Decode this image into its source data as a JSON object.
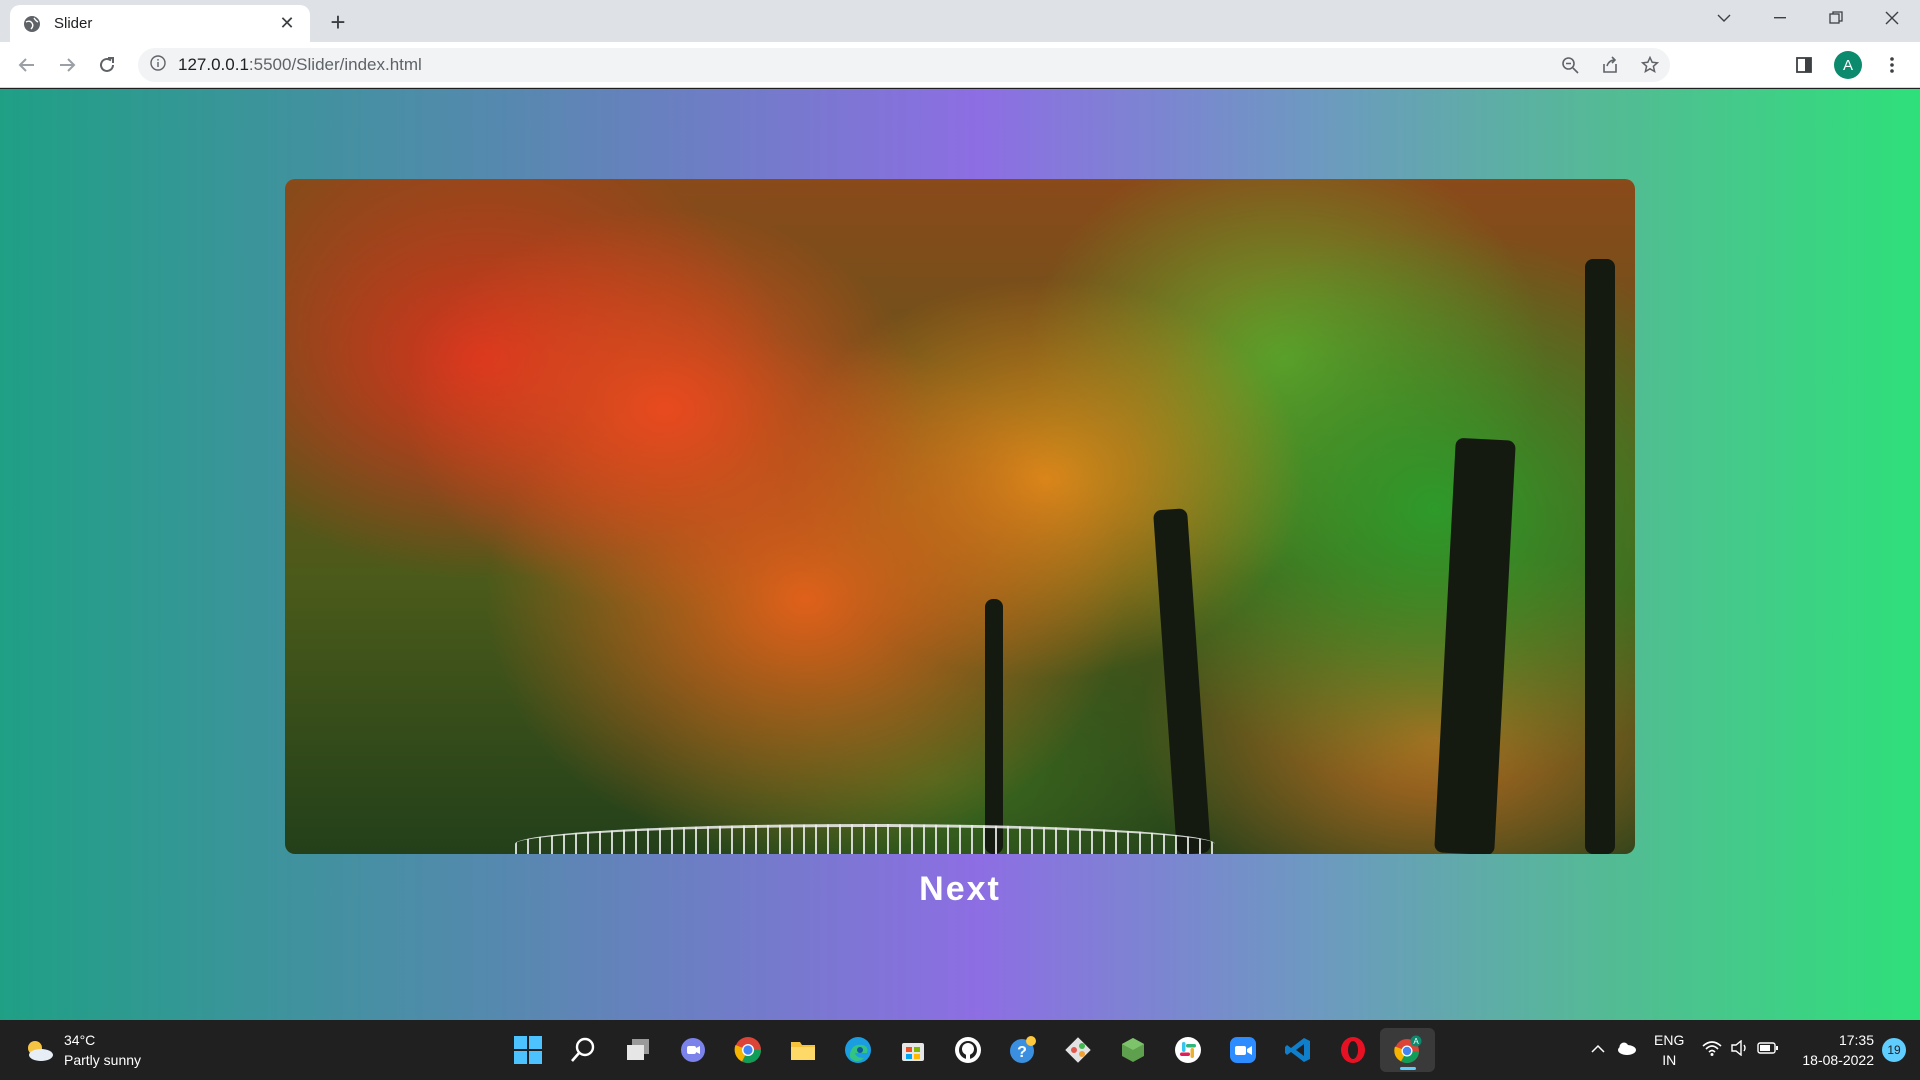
{
  "browser": {
    "tab_title": "Slider",
    "url_host": "127.0.0.1",
    "url_rest": ":5500/Slider/index.html",
    "profile_initial": "A",
    "icons": {
      "back": "arrow-left-icon",
      "forward": "arrow-right-icon",
      "reload": "reload-icon",
      "site_info": "info-icon",
      "zoom": "zoom-icon",
      "share": "share-icon",
      "bookmark": "star-icon",
      "side_panel": "side-panel-icon",
      "menu": "kebab-menu-icon"
    }
  },
  "page": {
    "slide_image": "autumn-forest-image",
    "next_label": "Next",
    "gradient_colors": [
      "#1fa085",
      "#8d6ee3",
      "#2ee07a"
    ]
  },
  "taskbar": {
    "weather_temp": "34°C",
    "weather_desc": "Partly sunny",
    "apps": [
      "windows-start-icon",
      "search-icon",
      "task-view-icon",
      "teams-chat-icon",
      "chrome-icon",
      "file-explorer-icon",
      "edge-icon",
      "store-icon",
      "github-icon",
      "help-icon",
      "git-icon",
      "node-icon",
      "slack-icon",
      "zoom-icon",
      "vscode-icon",
      "opera-icon",
      "chrome-profile-icon"
    ],
    "lang_top": "ENG",
    "lang_bottom": "IN",
    "time": "17:35",
    "date": "18-08-2022",
    "notification_count": "19"
  }
}
